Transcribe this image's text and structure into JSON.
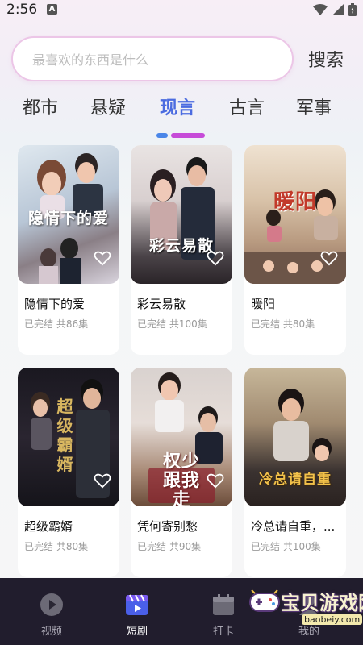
{
  "status_bar": {
    "time": "2:56",
    "notification_badge": "A"
  },
  "search": {
    "placeholder": "最喜欢的东西是什么",
    "button_label": "搜索"
  },
  "tabs": [
    {
      "label": "都市",
      "active": false
    },
    {
      "label": "悬疑",
      "active": false
    },
    {
      "label": "现言",
      "active": true
    },
    {
      "label": "古言",
      "active": false
    },
    {
      "label": "军事",
      "active": false
    }
  ],
  "dramas": [
    {
      "title": "隐情下的爱",
      "meta": "已完结 共86集",
      "poster_text": "隐情下的爱"
    },
    {
      "title": "彩云易散",
      "meta": "已完结 共100集",
      "poster_text": "彩云易散"
    },
    {
      "title": "暖阳",
      "meta": "已完结 共80集",
      "poster_text": "暖阳"
    },
    {
      "title": "超级霸婿",
      "meta": "已完结 共80集",
      "poster_text": "超级霸婿"
    },
    {
      "title": "凭何寄别愁",
      "meta": "已完结 共90集",
      "poster_text": "权少跟我走"
    },
    {
      "title": "冷总请自重，...",
      "meta": "已完结 共100集",
      "poster_text": "冷总请自重"
    }
  ],
  "bottom_nav": [
    {
      "label": "视频",
      "icon": "play-circle-icon",
      "active": false
    },
    {
      "label": "短剧",
      "icon": "clapperboard-icon",
      "active": true
    },
    {
      "label": "打卡",
      "icon": "calendar-icon",
      "active": false
    },
    {
      "label": "我的",
      "icon": "user-icon",
      "active": false
    }
  ],
  "watermark": {
    "text": "宝贝游戏网",
    "url": "baobeiy.com"
  },
  "colors": {
    "accent_active_tab": "#4b6be0",
    "indicator_blue": "#4a86e8",
    "indicator_purple": "#c64bd8",
    "nav_background": "#211d2d"
  }
}
